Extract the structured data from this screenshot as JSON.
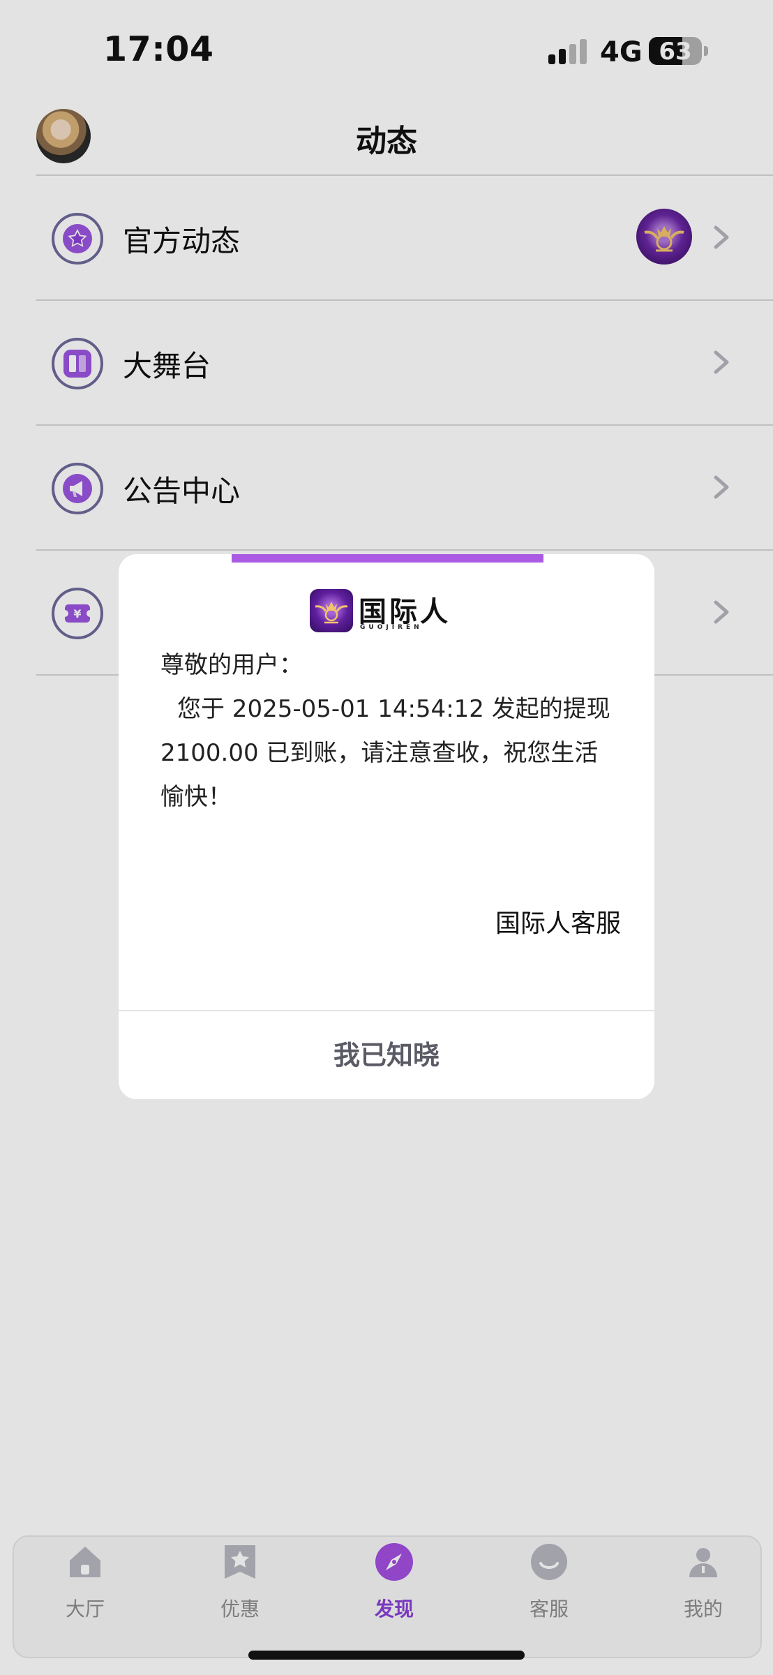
{
  "status_bar": {
    "time": "17:04",
    "network": "4G",
    "battery": "63",
    "battery_level": 0.63
  },
  "nav": {
    "title": "动态"
  },
  "list_items": [
    {
      "label": "官方动态",
      "icon": "star-icon"
    },
    {
      "label": "大舞台",
      "icon": "stage-icon"
    },
    {
      "label": "公告中心",
      "icon": "megaphone-icon"
    },
    {
      "label": "",
      "icon": "ticket-icon"
    }
  ],
  "dialog": {
    "brand_name": "国际人",
    "brand_sub": "GUOJIREN",
    "greeting": "尊敬的用户：",
    "message": "您于 2025-05-01 14:54:12 发起的提现 2100.00 已到账，请注意查收，祝您生活愉快！",
    "signoff": "国际人客服",
    "button": "我已知晓"
  },
  "tabbar": [
    {
      "label": "大厅",
      "icon": "home-icon",
      "active": false
    },
    {
      "label": "优惠",
      "icon": "promo-star-icon",
      "active": false
    },
    {
      "label": "发现",
      "icon": "compass-icon",
      "active": true
    },
    {
      "label": "客服",
      "icon": "support-icon",
      "active": false
    },
    {
      "label": "我的",
      "icon": "profile-icon",
      "active": false
    }
  ],
  "colors": {
    "accent": "#8a3fd6",
    "dialog_accent": "#ab5be3",
    "icon_ring": "#6e6a9a"
  }
}
